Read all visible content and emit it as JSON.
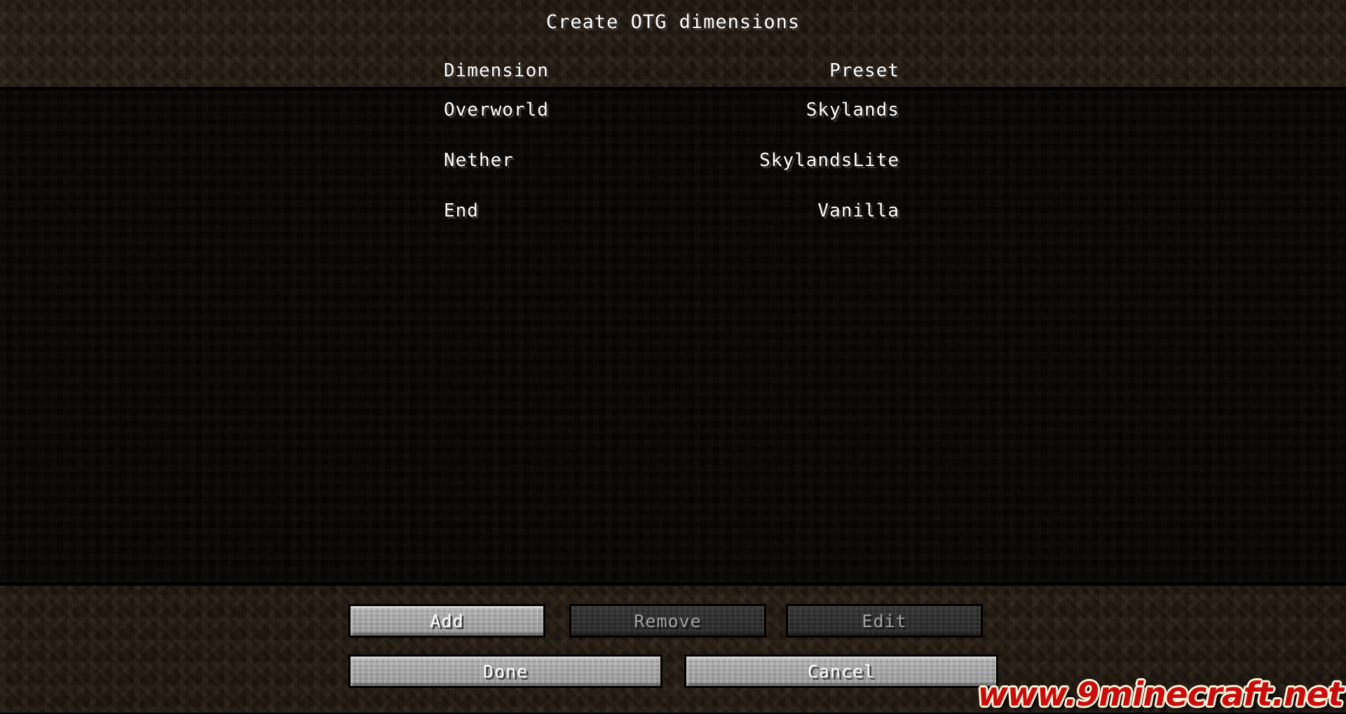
{
  "screen": {
    "title": "Create OTG dimensions",
    "background_color": "#31241a",
    "panel_color": "#0d0a07",
    "text_color": "#ffffff"
  },
  "table": {
    "columns": [
      {
        "key": "dimension",
        "label": "Dimension",
        "align": "left"
      },
      {
        "key": "preset",
        "label": "Preset",
        "align": "right"
      }
    ],
    "rows": [
      {
        "dimension": "Overworld",
        "preset": "Skylands"
      },
      {
        "dimension": "Nether",
        "preset": "SkylandsLite"
      },
      {
        "dimension": "End",
        "preset": "Vanilla"
      }
    ]
  },
  "buttons": {
    "action_row": [
      {
        "label": "Add",
        "enabled": true
      },
      {
        "label": "Remove",
        "enabled": false
      },
      {
        "label": "Edit",
        "enabled": false
      }
    ],
    "confirm_row": [
      {
        "label": "Done",
        "enabled": true
      },
      {
        "label": "Cancel",
        "enabled": true
      }
    ]
  },
  "watermark": {
    "text": "www.9minecraft.net",
    "color": "#c90d0d",
    "outline_color": "#fdf5dc"
  }
}
